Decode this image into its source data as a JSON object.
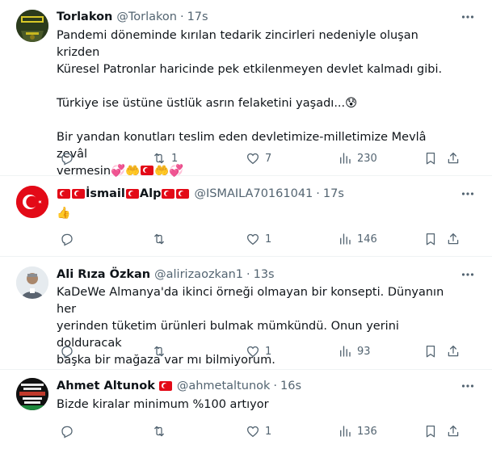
{
  "tweets": [
    {
      "name": "Torlakon",
      "handle": "@Torlakon",
      "sep": "·",
      "time": "17s",
      "lines": [
        "Pandemi döneminde kırılan tedarik zincirleri nedeniyle oluşan krizden",
        "Küresel Patronlar haricinde pek etkilenmeyen devlet kalmadı gibi.",
        "Türkiye ise üstüne üstlük asrın felaketini yaşadı...😰",
        "Bir yandan konutları teslim eden devletimize-milletimize Mevlâ zevâl",
        "vermesin💞🤲",
        "🤲💞"
      ],
      "reply_count": "",
      "retweet_count": "1",
      "like_count": "7",
      "view_count": "230"
    },
    {
      "name_a": "İsmail",
      "name_b": "Alp",
      "handle": "@ISMAILA70161041",
      "sep": "·",
      "time": "17s",
      "text": "👍",
      "reply_count": "",
      "retweet_count": "",
      "like_count": "1",
      "view_count": "146"
    },
    {
      "name": "Ali Rıza Özkan",
      "handle": "@alirizaozkan1",
      "sep": "·",
      "time": "13s",
      "lines": [
        "KaDeWe Almanya'da ikinci örneği olmayan bir konsepti. Dünyanın her",
        "yerinden tüketim ürünleri bulmak mümkündü. Onun yerini dolduracak",
        "başka bir mağaza var mı bilmiyorum."
      ],
      "reply_count": "",
      "retweet_count": "",
      "like_count": "1",
      "view_count": "93"
    },
    {
      "name": "Ahmet Altunok",
      "handle": "@ahmetaltunok",
      "sep": "·",
      "time": "16s",
      "text": "Bizde kiralar minimum %100 artıyor",
      "reply_count": "",
      "retweet_count": "",
      "like_count": "1",
      "view_count": "136"
    }
  ],
  "icons": {
    "reply": "reply-icon",
    "retweet": "retweet-icon",
    "like": "heart-icon",
    "views": "views-icon",
    "bookmark": "bookmark-icon",
    "share": "share-icon",
    "more": "more-icon"
  },
  "colors": {
    "text": "#0f1419",
    "secondary": "#536471",
    "divider": "#eff3f4",
    "flag_red": "#e30a17"
  }
}
